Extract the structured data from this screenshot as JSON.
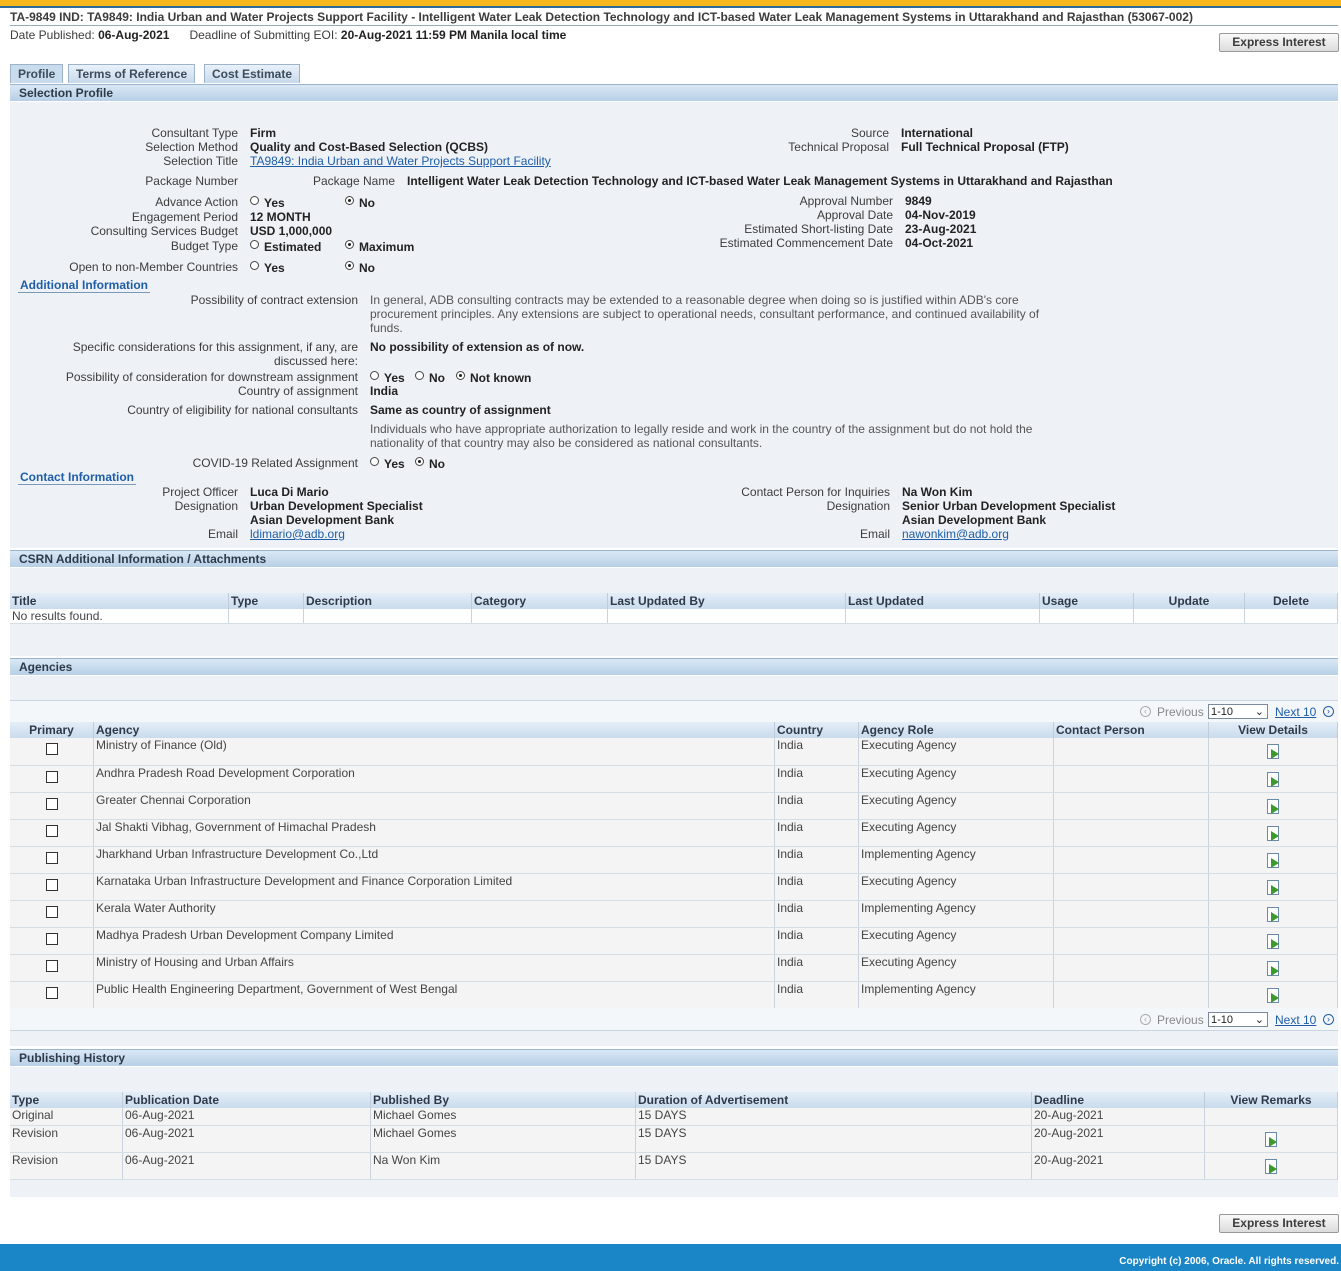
{
  "header": {
    "title": "TA-9849 IND: TA9849: India Urban and Water Projects Support Facility - Intelligent Water Leak Detection Technology and ICT-based Water Leak Management Systems in Uttarakhand and Rajasthan (53067-002)",
    "date_published_label": "Date Published:",
    "date_published": "06-Aug-2021",
    "deadline_label": "Deadline of Submitting EOI:",
    "deadline": "20-Aug-2021 11:59 PM Manila local time",
    "express_interest": "Express Interest"
  },
  "tabs": [
    "Profile",
    "Terms of Reference",
    "Cost Estimate"
  ],
  "selection_profile": {
    "heading": "Selection Profile",
    "consultant_type_label": "Consultant Type",
    "consultant_type": "Firm",
    "selection_method_label": "Selection Method",
    "selection_method": "Quality and Cost-Based Selection (QCBS)",
    "selection_title_label": "Selection Title",
    "selection_title": "TA9849: India Urban and Water Projects Support Facility",
    "source_label": "Source",
    "source": "International",
    "technical_proposal_label": "Technical Proposal",
    "technical_proposal": "Full Technical Proposal (FTP)",
    "package_number_label": "Package Number",
    "package_name_label": "Package Name",
    "package_name": "Intelligent Water Leak Detection Technology and ICT-based Water Leak Management Systems in Uttarakhand and Rajasthan",
    "advance_action_label": "Advance Action",
    "yes": "Yes",
    "no": "No",
    "engagement_period_label": "Engagement Period",
    "engagement_period": "12 MONTH",
    "budget_label": "Consulting Services Budget",
    "budget": "USD 1,000,000",
    "budget_type_label": "Budget Type",
    "estimated": "Estimated",
    "maximum": "Maximum",
    "open_label": "Open to non-Member Countries",
    "approval_number_label": "Approval Number",
    "approval_number": "9849",
    "approval_date_label": "Approval Date",
    "approval_date": "04-Nov-2019",
    "shortlisting_label": "Estimated Short-listing Date",
    "shortlisting": "23-Aug-2021",
    "commencement_label": "Estimated Commencement Date",
    "commencement": "04-Oct-2021"
  },
  "additional": {
    "heading": "Additional Information",
    "extension_label": "Possibility of contract extension",
    "extension_text": "In general, ADB consulting contracts may be extended to a reasonable degree when doing so is justified within ADB's core procurement principles. Any extensions are subject to operational needs, consultant performance, and continued availability of funds.",
    "specific_label": "Specific considerations for this assignment, if any, are discussed here:",
    "specific_value": "No possibility of extension as of now.",
    "downstream_label": "Possibility of consideration for downstream assignment",
    "not_known": "Not known",
    "country_label": "Country of assignment",
    "country": "India",
    "eligibility_label": "Country of eligibility for national consultants",
    "eligibility": "Same as country of assignment",
    "eligibility_note": "Individuals who have appropriate authorization to legally reside and work in the country of the assignment but do not hold the nationality of that country may also be considered as national consultants.",
    "covid_label": "COVID-19 Related Assignment"
  },
  "contact": {
    "heading": "Contact Information",
    "officer_label": "Project Officer",
    "officer": "Luca Di Mario",
    "designation_label": "Designation",
    "officer_designation": "Urban Development Specialist",
    "org": "Asian Development Bank",
    "email_label": "Email",
    "officer_email": "ldimario@adb.org",
    "inquiries_label": "Contact Person for Inquiries",
    "inquiries": "Na Won Kim",
    "inquiries_designation": "Senior Urban Development Specialist",
    "inquiries_email": "nawonkim@adb.org"
  },
  "csrn": {
    "heading": "CSRN Additional Information / Attachments",
    "columns": [
      "Title",
      "Type",
      "Description",
      "Category",
      "Last Updated By",
      "Last Updated",
      "Usage",
      "Update",
      "Delete"
    ],
    "empty": "No results found."
  },
  "agencies": {
    "heading": "Agencies",
    "previous": "Previous",
    "range": "1-10",
    "next": "Next 10",
    "columns": [
      "Primary",
      "Agency",
      "Country",
      "Agency Role",
      "Contact Person",
      "View Details"
    ],
    "rows": [
      {
        "agency": "Ministry of Finance (Old)",
        "country": "India",
        "role": "Executing Agency"
      },
      {
        "agency": "Andhra Pradesh Road Development Corporation",
        "country": "India",
        "role": "Executing Agency"
      },
      {
        "agency": "Greater Chennai Corporation",
        "country": "India",
        "role": "Executing Agency"
      },
      {
        "agency": "Jal Shakti Vibhag, Government of Himachal Pradesh",
        "country": "India",
        "role": "Executing Agency"
      },
      {
        "agency": "Jharkhand Urban Infrastructure Development Co.,Ltd",
        "country": "India",
        "role": "Implementing Agency"
      },
      {
        "agency": "Karnataka Urban Infrastructure Development and Finance Corporation Limited",
        "country": "India",
        "role": "Executing Agency"
      },
      {
        "agency": "Kerala Water Authority",
        "country": "India",
        "role": "Implementing Agency"
      },
      {
        "agency": "Madhya Pradesh Urban Development Company Limited",
        "country": "India",
        "role": "Executing Agency"
      },
      {
        "agency": "Ministry of Housing and Urban Affairs",
        "country": "India",
        "role": "Executing Agency"
      },
      {
        "agency": "Public Health Engineering Department, Government of West Bengal",
        "country": "India",
        "role": "Implementing Agency"
      }
    ]
  },
  "history": {
    "heading": "Publishing History",
    "columns": [
      "Type",
      "Publication Date",
      "Published By",
      "Duration of Advertisement",
      "Deadline",
      "View Remarks"
    ],
    "rows": [
      {
        "type": "Original",
        "date": "06-Aug-2021",
        "by": "Michael Gomes",
        "duration": "15 DAYS",
        "deadline": "20-Aug-2021",
        "remarks": false
      },
      {
        "type": "Revision",
        "date": "06-Aug-2021",
        "by": "Michael Gomes",
        "duration": "15 DAYS",
        "deadline": "20-Aug-2021",
        "remarks": true
      },
      {
        "type": "Revision",
        "date": "06-Aug-2021",
        "by": "Na Won Kim",
        "duration": "15 DAYS",
        "deadline": "20-Aug-2021",
        "remarks": true
      }
    ]
  },
  "footer": {
    "copyright": "Copyright (c) 2006, Oracle. All rights reserved."
  }
}
